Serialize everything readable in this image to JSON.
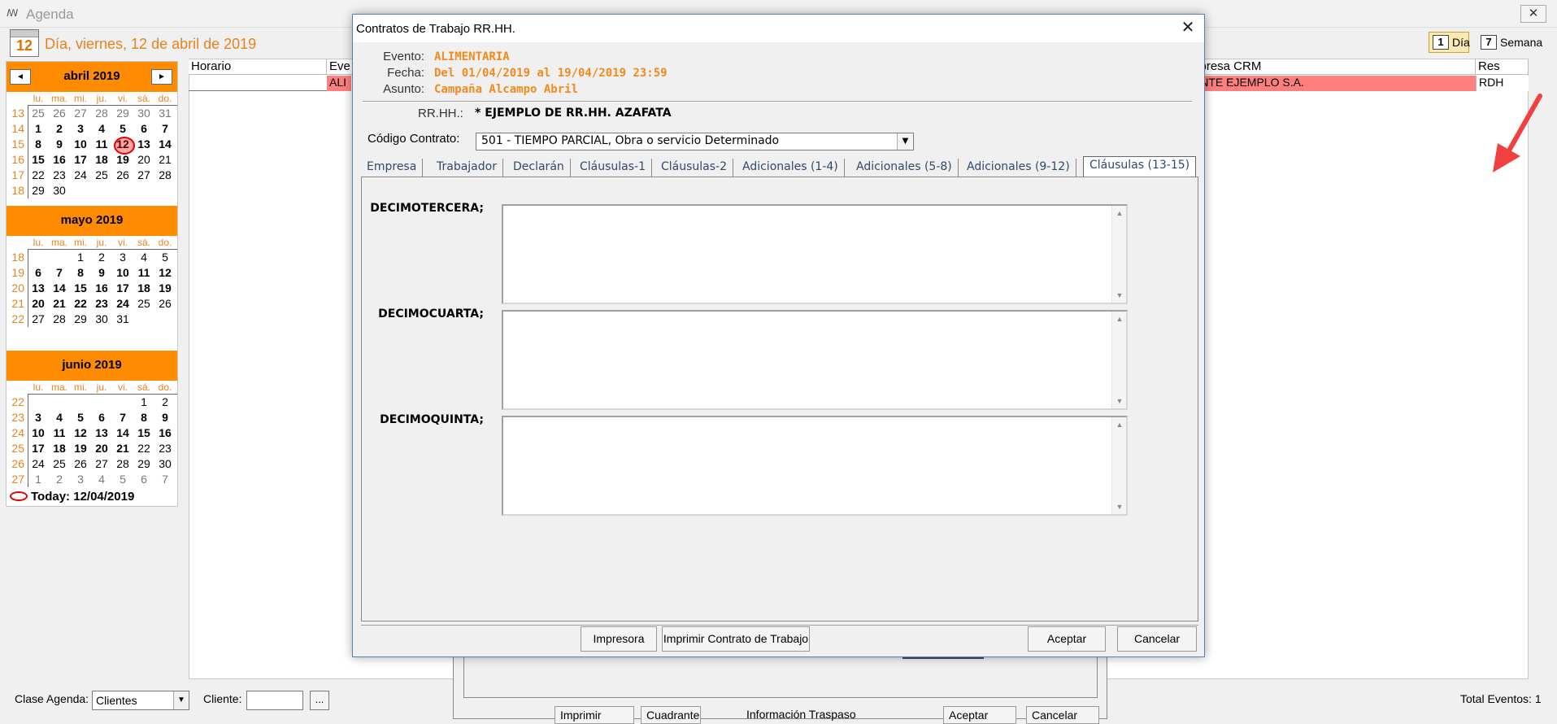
{
  "agenda": {
    "title": "Agenda",
    "date_icon_day": "12",
    "date_header": "Día, viernes, 12 de abril de 2019",
    "view_buttons": [
      {
        "icon": "1",
        "label": "Día"
      },
      {
        "icon": "7",
        "label": "Semana"
      }
    ],
    "close_glyph": "✕",
    "grid_columns": {
      "horario": "Horario",
      "evento": "Eve",
      "empresa_crm": "mpresa CRM",
      "res": "Res"
    },
    "row": {
      "evento_cut": "ALI",
      "empresa": "IENTE EJEMPLO S.A.",
      "res": "RDH"
    },
    "bottom": {
      "clase_label": "Clase Agenda:",
      "clase_value": "Clientes",
      "cliente_label": "Cliente:",
      "cliente_value": "",
      "more_glyph": "...",
      "total_eventos": "Total Eventos: 1",
      "bg_buttons": [
        "Imprimir Evento",
        "Cuadrante",
        "Información Traspaso",
        "Aceptar",
        "Cancelar"
      ]
    }
  },
  "calendar": {
    "dow": [
      "lu.",
      "ma.",
      "mi.",
      "ju.",
      "vi.",
      "sá.",
      "do."
    ],
    "today_label": "Today: 12/04/2019",
    "months": [
      {
        "title": "abril 2019",
        "weeks": [
          {
            "wk": "13",
            "days": [
              [
                "25",
                "g"
              ],
              [
                "26",
                "g"
              ],
              [
                "27",
                "g"
              ],
              [
                "28",
                "g"
              ],
              [
                "29",
                "g"
              ],
              [
                "30",
                "g"
              ],
              [
                "31",
                "g"
              ]
            ]
          },
          {
            "wk": "14",
            "days": [
              [
                "1",
                "b"
              ],
              [
                "2",
                "b"
              ],
              [
                "3",
                "b"
              ],
              [
                "4",
                "b"
              ],
              [
                "5",
                "b"
              ],
              [
                "6",
                "b"
              ],
              [
                "7",
                "b"
              ]
            ]
          },
          {
            "wk": "15",
            "days": [
              [
                "8",
                "b"
              ],
              [
                "9",
                "b"
              ],
              [
                "10",
                "b"
              ],
              [
                "11",
                "b"
              ],
              [
                "12",
                "t"
              ],
              [
                "13",
                "b"
              ],
              [
                "14",
                "b"
              ]
            ]
          },
          {
            "wk": "16",
            "days": [
              [
                "15",
                "b"
              ],
              [
                "16",
                "b"
              ],
              [
                "17",
                "b"
              ],
              [
                "18",
                "b"
              ],
              [
                "19",
                "b"
              ],
              [
                "20",
                "n"
              ],
              [
                "21",
                "n"
              ]
            ]
          },
          {
            "wk": "17",
            "days": [
              [
                "22",
                "n"
              ],
              [
                "23",
                "n"
              ],
              [
                "24",
                "n"
              ],
              [
                "25",
                "n"
              ],
              [
                "26",
                "n"
              ],
              [
                "27",
                "n"
              ],
              [
                "28",
                "n"
              ]
            ]
          },
          {
            "wk": "18",
            "days": [
              [
                "29",
                "n"
              ],
              [
                "30",
                "n"
              ]
            ]
          }
        ]
      },
      {
        "title": "mayo 2019",
        "weeks": [
          {
            "wk": "18",
            "days": [
              [
                "",
                ""
              ],
              [
                "",
                ""
              ],
              [
                "1",
                "n"
              ],
              [
                "2",
                "n"
              ],
              [
                "3",
                "n"
              ],
              [
                "4",
                "n"
              ],
              [
                "5",
                "n"
              ]
            ]
          },
          {
            "wk": "19",
            "days": [
              [
                "6",
                "b"
              ],
              [
                "7",
                "b"
              ],
              [
                "8",
                "b"
              ],
              [
                "9",
                "b"
              ],
              [
                "10",
                "b"
              ],
              [
                "11",
                "b"
              ],
              [
                "12",
                "b"
              ]
            ]
          },
          {
            "wk": "20",
            "days": [
              [
                "13",
                "b"
              ],
              [
                "14",
                "b"
              ],
              [
                "15",
                "b"
              ],
              [
                "16",
                "b"
              ],
              [
                "17",
                "b"
              ],
              [
                "18",
                "b"
              ],
              [
                "19",
                "b"
              ]
            ]
          },
          {
            "wk": "21",
            "days": [
              [
                "20",
                "b"
              ],
              [
                "21",
                "b"
              ],
              [
                "22",
                "b"
              ],
              [
                "23",
                "b"
              ],
              [
                "24",
                "b"
              ],
              [
                "25",
                "n"
              ],
              [
                "26",
                "n"
              ]
            ]
          },
          {
            "wk": "22",
            "days": [
              [
                "27",
                "n"
              ],
              [
                "28",
                "n"
              ],
              [
                "29",
                "n"
              ],
              [
                "30",
                "n"
              ],
              [
                "31",
                "n"
              ]
            ]
          }
        ]
      },
      {
        "title": "junio 2019",
        "weeks": [
          {
            "wk": "22",
            "days": [
              [
                "",
                ""
              ],
              [
                "",
                ""
              ],
              [
                "",
                ""
              ],
              [
                "",
                ""
              ],
              [
                "",
                ""
              ],
              [
                "1",
                "n"
              ],
              [
                "2",
                "n"
              ]
            ]
          },
          {
            "wk": "23",
            "days": [
              [
                "3",
                "b"
              ],
              [
                "4",
                "b"
              ],
              [
                "5",
                "b"
              ],
              [
                "6",
                "b"
              ],
              [
                "7",
                "b"
              ],
              [
                "8",
                "b"
              ],
              [
                "9",
                "b"
              ]
            ]
          },
          {
            "wk": "24",
            "days": [
              [
                "10",
                "b"
              ],
              [
                "11",
                "b"
              ],
              [
                "12",
                "b"
              ],
              [
                "13",
                "b"
              ],
              [
                "14",
                "b"
              ],
              [
                "15",
                "b"
              ],
              [
                "16",
                "b"
              ]
            ]
          },
          {
            "wk": "25",
            "days": [
              [
                "17",
                "b"
              ],
              [
                "18",
                "b"
              ],
              [
                "19",
                "b"
              ],
              [
                "20",
                "b"
              ],
              [
                "21",
                "b"
              ],
              [
                "22",
                "n"
              ],
              [
                "23",
                "n"
              ]
            ]
          },
          {
            "wk": "26",
            "days": [
              [
                "24",
                "n"
              ],
              [
                "25",
                "n"
              ],
              [
                "26",
                "n"
              ],
              [
                "27",
                "n"
              ],
              [
                "28",
                "n"
              ],
              [
                "29",
                "n"
              ],
              [
                "30",
                "n"
              ]
            ]
          },
          {
            "wk": "27",
            "days": [
              [
                "1",
                "g"
              ],
              [
                "2",
                "g"
              ],
              [
                "3",
                "g"
              ],
              [
                "4",
                "g"
              ],
              [
                "5",
                "g"
              ],
              [
                "6",
                "g"
              ],
              [
                "7",
                "g"
              ]
            ]
          }
        ]
      }
    ]
  },
  "dialog": {
    "title": "Contratos de Trabajo RR.HH.",
    "close_glyph": "✕",
    "evento_label": "Evento:",
    "evento_value": "ALIMENTARIA",
    "fecha_label": "Fecha:",
    "fecha_value": "Del 01/04/2019 al 19/04/2019 23:59",
    "asunto_label": "Asunto:",
    "asunto_value": "Campaña Alcampo Abril",
    "rrhh_label": "RR.HH.:",
    "rrhh_value": "* EJEMPLO DE RR.HH. AZAFATA",
    "codigo_label": "Código Contrato:",
    "codigo_value": "501 - TIEMPO PARCIAL, Obra o servicio Determinado",
    "tabs": [
      "Empresa",
      "Trabajador",
      "Declarán",
      "Cláusulas-1",
      "Cláusulas-2",
      "Adicionales (1-4)",
      "Adicionales (5-8)",
      "Adicionales (9-12)",
      "Cláusulas (13-15)"
    ],
    "active_tab": "Cláusulas (13-15)",
    "clauses": [
      {
        "label": "DECIMOTERCERA;",
        "value": ""
      },
      {
        "label": "DECIMOCUARTA;",
        "value": ""
      },
      {
        "label": "DECIMOQUINTA;",
        "value": ""
      }
    ],
    "buttons": {
      "impresora": "Impresora",
      "imprimir": "Imprimir Contrato de Trabajo",
      "aceptar": "Aceptar",
      "cancelar": "Cancelar"
    }
  },
  "colors": {
    "accent_orange": "#ff8c00",
    "highlight_red": "#ff7f7f",
    "annotation_arrow": "#f04040"
  }
}
